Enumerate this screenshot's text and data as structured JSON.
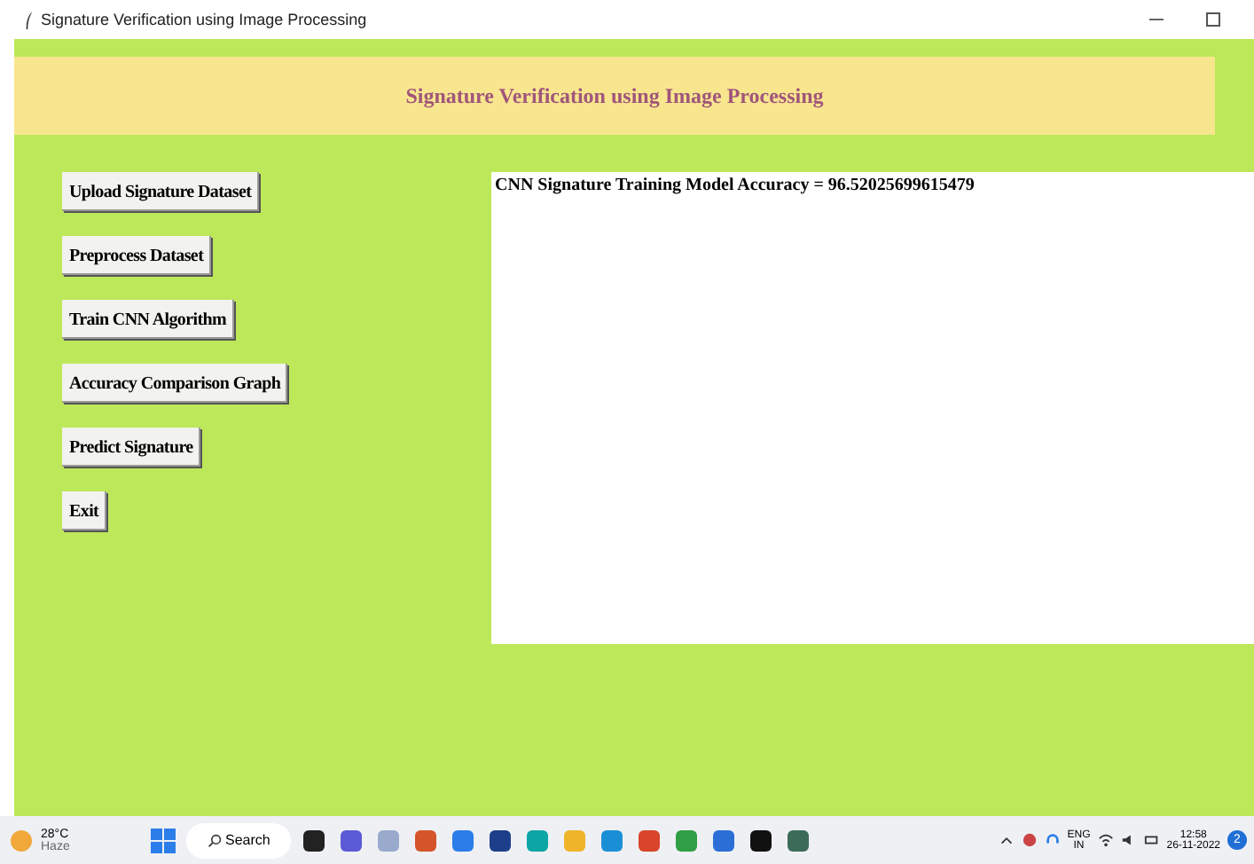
{
  "window": {
    "title": "Signature Verification using Image Processing"
  },
  "header": {
    "title": "Signature Verification using Image Processing"
  },
  "buttons": [
    "Upload Signature Dataset",
    "Preprocess Dataset",
    "Train CNN Algorithm",
    "Accuracy Comparison Graph",
    "Predict Signature",
    "Exit"
  ],
  "output": {
    "text": "CNN Signature Training Model Accuracy = 96.52025699615479"
  },
  "taskbar": {
    "weather": {
      "temperature": "28°C",
      "condition": "Haze"
    },
    "search": "Search",
    "language": "ENG",
    "region": "IN",
    "time": "12:58",
    "date": "26-11-2022",
    "notifications": "2"
  }
}
